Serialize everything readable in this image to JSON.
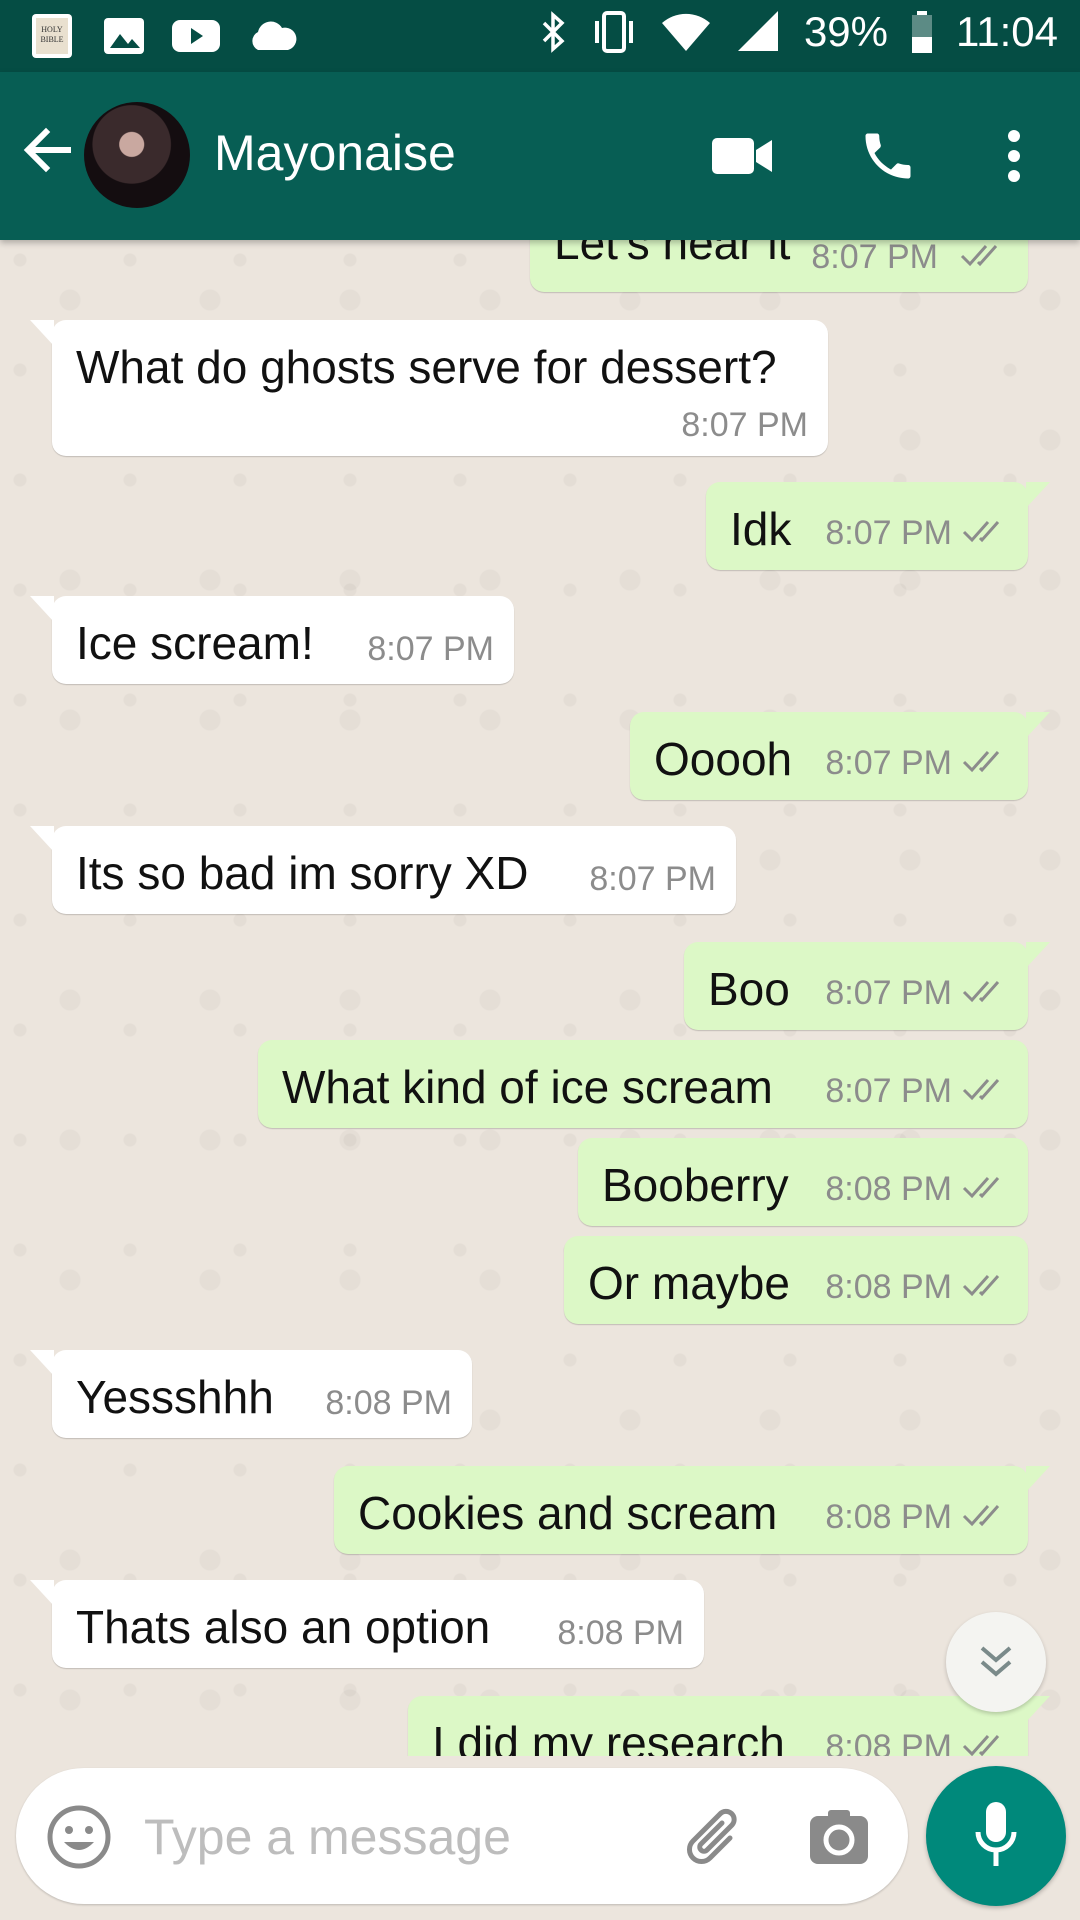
{
  "status_bar": {
    "battery": "39%",
    "time": "11:04",
    "left_icons": [
      "holy-bible-app-icon",
      "gallery-icon",
      "youtube-icon",
      "cloud-icon"
    ],
    "right_icons": [
      "bluetooth-icon",
      "vibrate-icon",
      "wifi-icon",
      "signal-icon",
      "battery-icon"
    ]
  },
  "header": {
    "contact_name": "Mayonaise",
    "actions": [
      "video-call-icon",
      "voice-call-icon",
      "more-options-icon"
    ]
  },
  "colors": {
    "header": "#075e54",
    "status_bar": "#054d44",
    "outgoing_bubble": "#dcf8c6",
    "incoming_bubble": "#ffffff",
    "chat_background": "#ece5dd",
    "mic_button": "#00897b"
  },
  "messages": [
    {
      "direction": "out",
      "text": "Let's hear it",
      "time": "8:07 PM",
      "status": "read"
    },
    {
      "direction": "in",
      "text": "What do ghosts serve for dessert?",
      "time": "8:07 PM"
    },
    {
      "direction": "out",
      "text": "Idk",
      "time": "8:07 PM",
      "status": "read"
    },
    {
      "direction": "in",
      "text": "Ice scream!",
      "time": "8:07 PM"
    },
    {
      "direction": "out",
      "text": "Ooooh",
      "time": "8:07 PM",
      "status": "read"
    },
    {
      "direction": "in",
      "text": "Its so bad im sorry XD",
      "time": "8:07 PM"
    },
    {
      "direction": "out",
      "text": "Boo",
      "time": "8:07 PM",
      "status": "read"
    },
    {
      "direction": "out",
      "text": "What kind of ice scream",
      "time": "8:07 PM",
      "status": "read"
    },
    {
      "direction": "out",
      "text": "Booberry",
      "time": "8:08 PM",
      "status": "read"
    },
    {
      "direction": "out",
      "text": "Or maybe",
      "time": "8:08 PM",
      "status": "read"
    },
    {
      "direction": "in",
      "text": "Yessshhh",
      "time": "8:08 PM"
    },
    {
      "direction": "out",
      "text": "Cookies and scream",
      "time": "8:08 PM",
      "status": "read"
    },
    {
      "direction": "in",
      "text": "Thats also an option",
      "time": "8:08 PM"
    },
    {
      "direction": "out",
      "text": "I did my research",
      "time": "8:08 PM",
      "status": "read"
    }
  ],
  "composer": {
    "placeholder": "Type a message",
    "value": ""
  }
}
